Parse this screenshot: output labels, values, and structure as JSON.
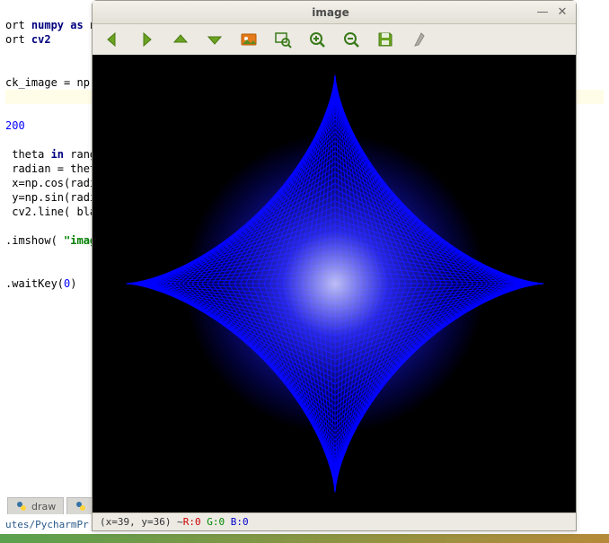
{
  "editor": {
    "lines": [
      {
        "pre": "ort ",
        "kw": "numpy",
        "mid": " ",
        "kw2": "as",
        "post": " np"
      },
      {
        "pre": "ort ",
        "kw": "cv2"
      },
      {
        "blank": true
      },
      {
        "blank": true
      },
      {
        "pre": "ck_image = np."
      },
      {
        "blank": true,
        "hl": true
      },
      {
        "blank": true
      },
      {
        "pre": "",
        "num": "200"
      },
      {
        "blank": true
      },
      {
        "pre": " theta ",
        "kw": "in",
        "post": " rang"
      },
      {
        "pre": " radian = thet"
      },
      {
        "pre": " x=np.cos(radi"
      },
      {
        "pre": " y=np.sin(radi"
      },
      {
        "pre": " cv2.line( bla"
      },
      {
        "blank": true
      },
      {
        "pre": ".imshow( ",
        "str": "\"imag"
      },
      {
        "blank": true
      },
      {
        "blank": true
      },
      {
        "pre": ".waitKey(",
        "num": "0",
        "post": ")"
      }
    ]
  },
  "tabs": [
    {
      "label": "draw"
    },
    {
      "label": "d"
    }
  ],
  "footer_path": "utes/PycharmPr",
  "window": {
    "title": "image",
    "status": {
      "coords": "(x=39, y=36) ~ ",
      "r": "R:0",
      "g": "G:0",
      "b": "B:0"
    }
  },
  "chart_data": {
    "type": "radial-lines",
    "center": [
      250,
      250
    ],
    "radius": 228,
    "line_count_approx": 200,
    "line_color": "#0000ff",
    "background": "#000000",
    "description": "Blue radial line pattern on black square generated by drawing lines for theta in range producing a starburst circle with bright dense center and a diamond-shaped brighter core"
  }
}
